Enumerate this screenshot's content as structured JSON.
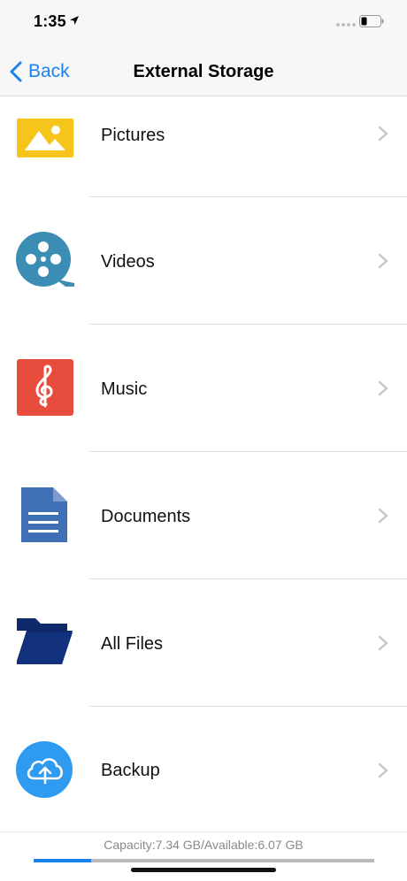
{
  "status_bar": {
    "time": "1:35"
  },
  "nav": {
    "back_label": "Back",
    "title": "External Storage"
  },
  "items": [
    {
      "label": "Pictures",
      "icon": "pictures-icon"
    },
    {
      "label": "Videos",
      "icon": "videos-icon"
    },
    {
      "label": "Music",
      "icon": "music-icon"
    },
    {
      "label": "Documents",
      "icon": "documents-icon"
    },
    {
      "label": "All Files",
      "icon": "folder-icon"
    },
    {
      "label": "Backup",
      "icon": "cloud-upload-icon"
    }
  ],
  "footer": {
    "capacity_text": "Capacity:7.34 GB/Available:6.07 GB",
    "used_fraction": 0.17
  },
  "colors": {
    "accent": "#1a82f0",
    "pictures": "#f6c51b",
    "videos": "#3b8db4",
    "music": "#e84c3d",
    "documents": "#3f6fb5",
    "folder": "#0f2a6b",
    "backup": "#2e9af0"
  }
}
